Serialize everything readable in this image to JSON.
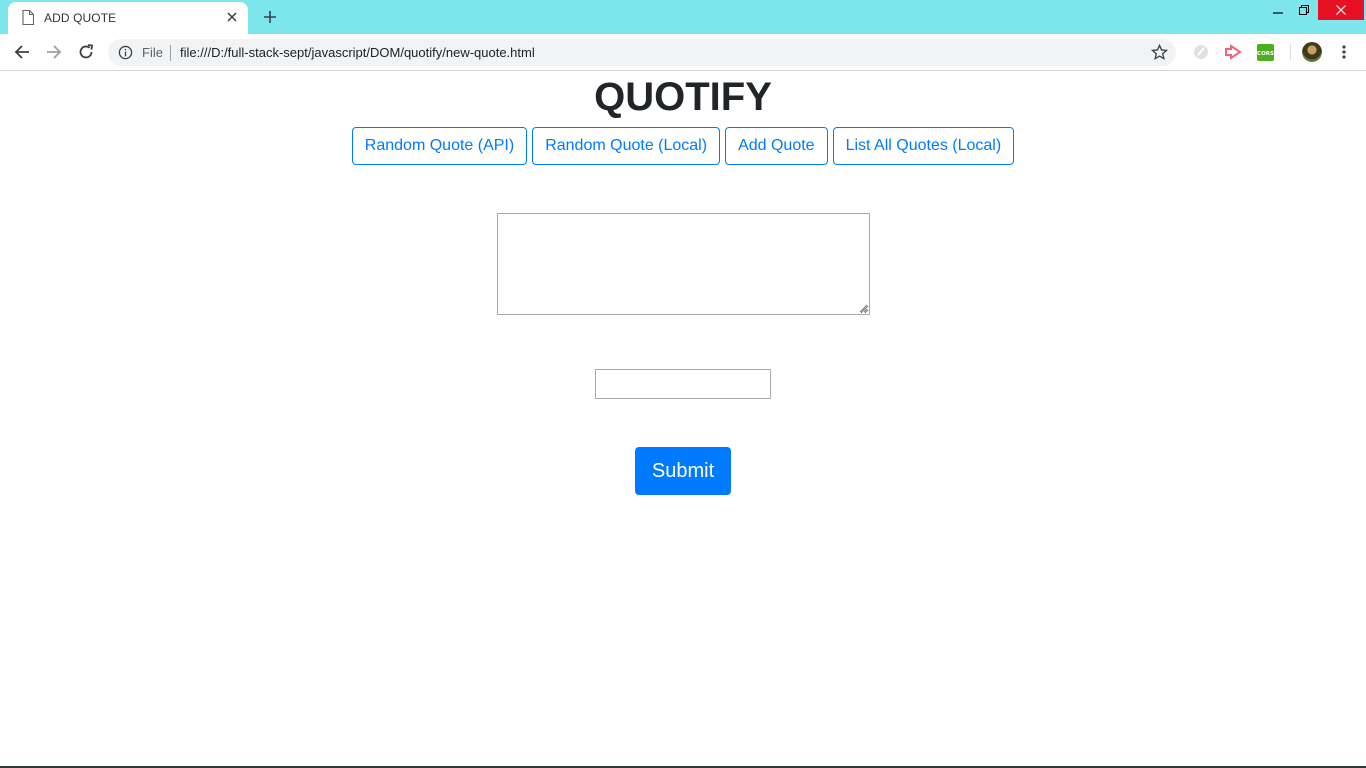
{
  "browser": {
    "tab": {
      "title": "ADD QUOTE"
    },
    "omnibox": {
      "scheme_label": "File",
      "url": "file:///D:/full-stack-sept/javascript/DOM/quotify/new-quote.html"
    },
    "extensions": [
      {
        "name": "circle-extension-icon"
      },
      {
        "name": "play-extension-icon",
        "color": "#f0637d"
      },
      {
        "name": "cors-extension-icon",
        "label": "CORS",
        "color": "#4caf1e"
      }
    ],
    "titlebar_color": "#7de5ec"
  },
  "page": {
    "title": "QUOTIFY",
    "nav_buttons": [
      {
        "label": "Random Quote (API)"
      },
      {
        "label": "Random Quote (Local)"
      },
      {
        "label": "Add Quote"
      },
      {
        "label": "List All Quotes (Local)"
      }
    ],
    "quote_field": {
      "value": ""
    },
    "author_field": {
      "value": ""
    },
    "submit_label": "Submit",
    "accent_color": "#007bff"
  }
}
